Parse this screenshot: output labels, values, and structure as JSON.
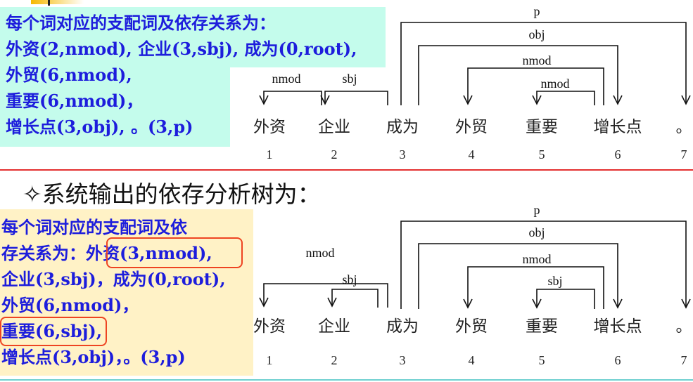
{
  "gold": {
    "lines": [
      "每个词对应的支配词及依存关系为：",
      "外资(2,nmod), 企业(3,sbj), 成为(0,root),",
      "外贸(6,nmod),",
      "重要(6,nmod)，",
      "增长点(3,obj), 。(3,p)"
    ],
    "words": [
      "外资",
      "企业",
      "成为",
      "外贸",
      "重要",
      "增长点",
      "。"
    ],
    "indices": [
      "1",
      "2",
      "3",
      "4",
      "5",
      "6",
      "7"
    ],
    "arcs": [
      {
        "head": 3,
        "dep": 7,
        "label": "p"
      },
      {
        "head": 3,
        "dep": 6,
        "label": "obj"
      },
      {
        "head": 6,
        "dep": 4,
        "label": "nmod"
      },
      {
        "head": 6,
        "dep": 5,
        "label": "nmod"
      },
      {
        "head": 2,
        "dep": 1,
        "label": "nmod"
      },
      {
        "head": 3,
        "dep": 2,
        "label": "sbj"
      }
    ]
  },
  "heading": "✧系统输出的依存分析树为：",
  "system": {
    "lines": [
      "每个词对应的支配词及依",
      "存关系为：外资(3,nmod),",
      "企业(3,sbj)，成为(0,root),",
      "外贸(6,nmod)，",
      "重要(6,sbj),",
      "增长点(3,obj)，。(3,p)"
    ],
    "words": [
      "外资",
      "企业",
      "成为",
      "外贸",
      "重要",
      "增长点",
      "。"
    ],
    "indices": [
      "1",
      "2",
      "3",
      "4",
      "5",
      "6",
      "7"
    ],
    "arcs": [
      {
        "head": 3,
        "dep": 7,
        "label": "p"
      },
      {
        "head": 3,
        "dep": 6,
        "label": "obj"
      },
      {
        "head": 6,
        "dep": 4,
        "label": "nmod"
      },
      {
        "head": 6,
        "dep": 5,
        "label": "sbj"
      },
      {
        "head": 3,
        "dep": 1,
        "label": "nmod"
      },
      {
        "head": 3,
        "dep": 2,
        "label": "sbj"
      }
    ],
    "highlighted_errors": [
      "外资(3,nmod)",
      "重要(6,sbj)"
    ],
    "highlight_color": "#ee4422"
  }
}
